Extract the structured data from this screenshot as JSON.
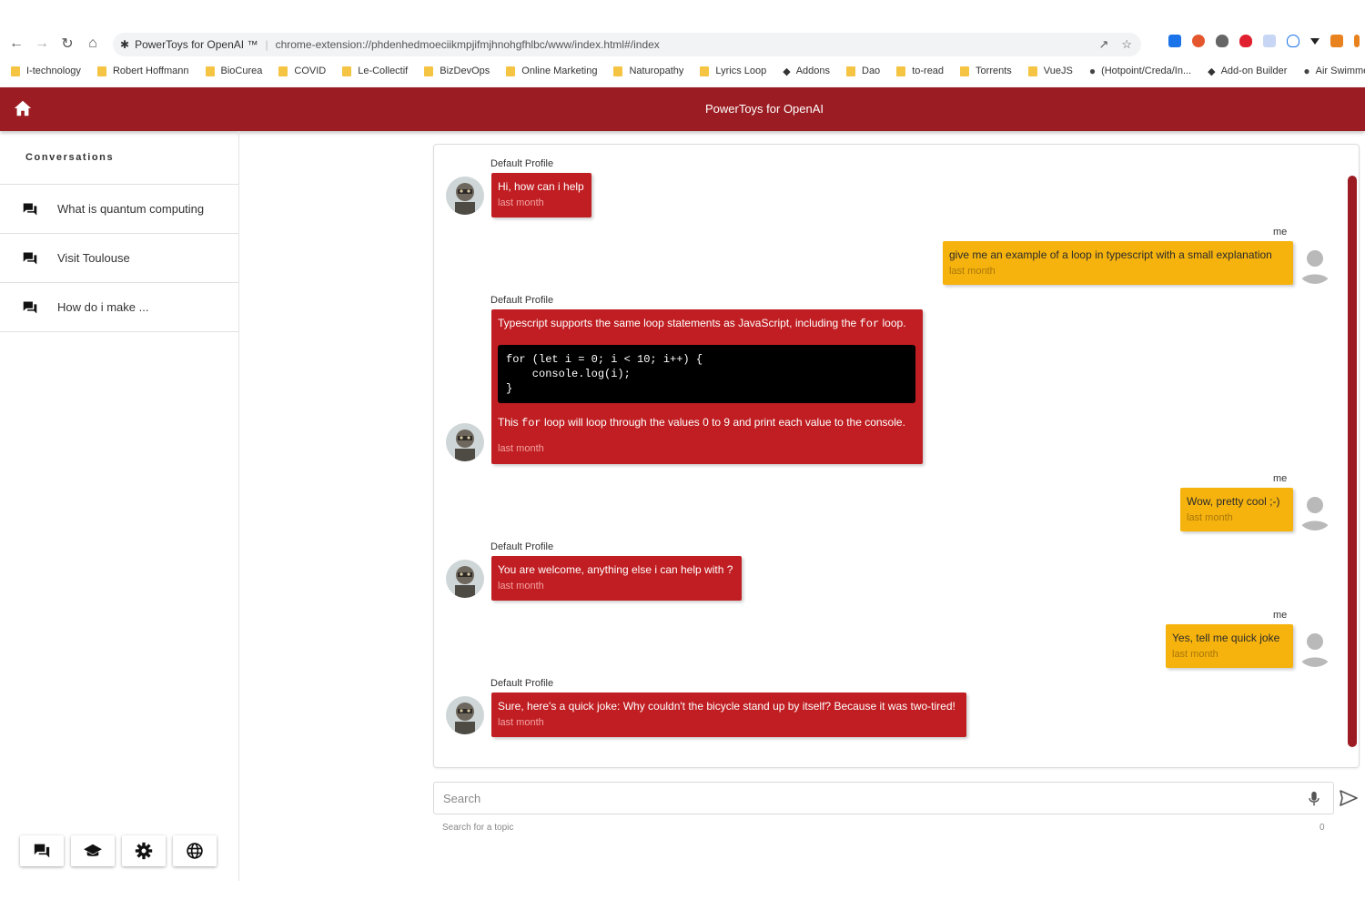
{
  "browser": {
    "site_name": "PowerToys for OpenAI ™",
    "url": "chrome-extension://phdenhedmoeciikmpjifmjhnohgfhlbc/www/index.html#/index",
    "bookmarks": [
      {
        "label": "I-technology",
        "type": "folder"
      },
      {
        "label": "Robert Hoffmann",
        "type": "folder"
      },
      {
        "label": "BioCurea",
        "type": "folder"
      },
      {
        "label": "COVID",
        "type": "folder"
      },
      {
        "label": "Le-Collectif",
        "type": "folder"
      },
      {
        "label": "BizDevOps",
        "type": "folder"
      },
      {
        "label": "Online Marketing",
        "type": "folder"
      },
      {
        "label": "Naturopathy",
        "type": "folder"
      },
      {
        "label": "Lyrics Loop",
        "type": "folder"
      },
      {
        "label": "Addons",
        "type": "link"
      },
      {
        "label": "Dao",
        "type": "folder"
      },
      {
        "label": "to-read",
        "type": "folder"
      },
      {
        "label": "Torrents",
        "type": "folder"
      },
      {
        "label": "VueJS",
        "type": "folder"
      },
      {
        "label": "(Hotpoint/Creda/In...",
        "type": "globe"
      },
      {
        "label": "Add-on Builder",
        "type": "link"
      },
      {
        "label": "Air Swimmers",
        "type": "globe"
      }
    ]
  },
  "header": {
    "title": "PowerToys for OpenAI"
  },
  "sidebar": {
    "heading": "Conversations",
    "items": [
      {
        "label": "What is quantum computing"
      },
      {
        "label": "Visit Toulouse"
      },
      {
        "label": "How do i make ..."
      }
    ]
  },
  "chat": {
    "messages": [
      {
        "sender": "Default Profile",
        "text": "Hi, how can i help",
        "time": "last month"
      },
      {
        "sender": "me",
        "text": "give me an example of a loop in typescript with a small explanation",
        "time": "last month"
      },
      {
        "sender": "Default Profile",
        "text_before": "Typescript supports the same loop statements as JavaScript, including the",
        "inline_code": "for",
        "text_before_end": "loop.",
        "code": "for (let i = 0; i < 10; i++) {\n    console.log(i);\n}",
        "text_after_start": "This",
        "inline_code_2": "for",
        "text_after": "loop will loop through the values 0 to 9 and print each value to the console.",
        "time": "last month"
      },
      {
        "sender": "me",
        "text": "Wow, pretty cool ;-)",
        "time": "last month"
      },
      {
        "sender": "Default Profile",
        "text": "You are welcome, anything else i can help with ?",
        "time": "last month"
      },
      {
        "sender": "me",
        "text": "Yes, tell me quick joke",
        "time": "last month"
      },
      {
        "sender": "Default Profile",
        "text": "Sure, here's a quick joke: Why couldn't the bicycle stand up by itself? Because it was two-tired!",
        "time": "last month"
      }
    ]
  },
  "input": {
    "placeholder": "Search",
    "hint": "Search for a topic",
    "counter": "0"
  },
  "colors": {
    "brand": "#9b1c22",
    "bot_bubble": "#c01e22",
    "user_bubble": "#f6b30e"
  }
}
